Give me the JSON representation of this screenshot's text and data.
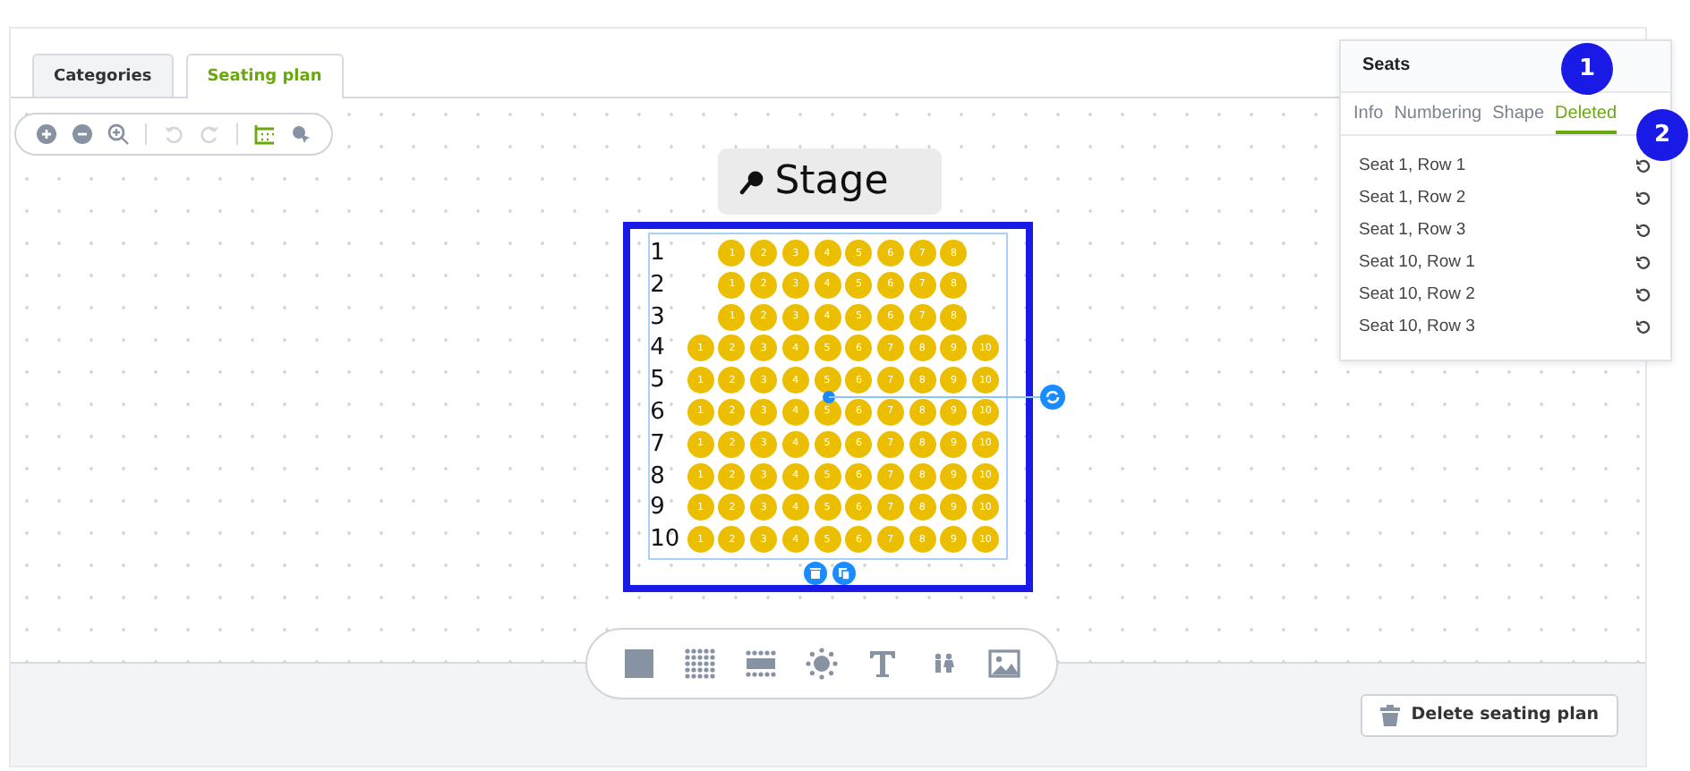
{
  "tabs": [
    {
      "label": "Categories",
      "selected": false
    },
    {
      "label": "Seating plan",
      "selected": true
    }
  ],
  "canvas_toolbar": [
    {
      "kind": "zoom-in",
      "disabled": false
    },
    {
      "kind": "zoom-out",
      "disabled": false
    },
    {
      "kind": "zoom-fit",
      "disabled": false
    },
    {
      "kind": "undo",
      "disabled": true
    },
    {
      "kind": "redo",
      "disabled": true
    },
    {
      "kind": "grid",
      "disabled": false
    },
    {
      "kind": "pointer",
      "disabled": false
    }
  ],
  "stage": {
    "label": "Stage"
  },
  "seat_block": {
    "selected": true,
    "rows": [
      {
        "label": "1",
        "seats": [
          {
            "kind": "gap"
          },
          {
            "kind": "seat",
            "label": "1"
          },
          {
            "kind": "seat",
            "label": "2"
          },
          {
            "kind": "seat",
            "label": "3"
          },
          {
            "kind": "seat",
            "label": "4"
          },
          {
            "kind": "seat",
            "label": "5"
          },
          {
            "kind": "seat",
            "label": "6"
          },
          {
            "kind": "seat",
            "label": "7"
          },
          {
            "kind": "seat",
            "label": "8"
          },
          {
            "kind": "gap"
          }
        ]
      },
      {
        "label": "2",
        "seats": [
          {
            "kind": "gap"
          },
          {
            "kind": "seat",
            "label": "1"
          },
          {
            "kind": "seat",
            "label": "2"
          },
          {
            "kind": "seat",
            "label": "3"
          },
          {
            "kind": "seat",
            "label": "4"
          },
          {
            "kind": "seat",
            "label": "5"
          },
          {
            "kind": "seat",
            "label": "6"
          },
          {
            "kind": "seat",
            "label": "7"
          },
          {
            "kind": "seat",
            "label": "8"
          },
          {
            "kind": "gap"
          }
        ]
      },
      {
        "label": "3",
        "seats": [
          {
            "kind": "gap"
          },
          {
            "kind": "seat",
            "label": "1"
          },
          {
            "kind": "seat",
            "label": "2"
          },
          {
            "kind": "seat",
            "label": "3"
          },
          {
            "kind": "seat",
            "label": "4"
          },
          {
            "kind": "seat",
            "label": "5"
          },
          {
            "kind": "seat",
            "label": "6"
          },
          {
            "kind": "seat",
            "label": "7"
          },
          {
            "kind": "seat",
            "label": "8"
          },
          {
            "kind": "gap"
          }
        ]
      },
      {
        "label": "4",
        "seats": [
          {
            "kind": "seat",
            "label": "1"
          },
          {
            "kind": "seat",
            "label": "2"
          },
          {
            "kind": "seat",
            "label": "3"
          },
          {
            "kind": "seat",
            "label": "4"
          },
          {
            "kind": "seat",
            "label": "5"
          },
          {
            "kind": "seat",
            "label": "6"
          },
          {
            "kind": "seat",
            "label": "7"
          },
          {
            "kind": "seat",
            "label": "8"
          },
          {
            "kind": "seat",
            "label": "9"
          },
          {
            "kind": "seat",
            "label": "10"
          }
        ]
      },
      {
        "label": "5",
        "seats": [
          {
            "kind": "seat",
            "label": "1"
          },
          {
            "kind": "seat",
            "label": "2"
          },
          {
            "kind": "seat",
            "label": "3"
          },
          {
            "kind": "seat",
            "label": "4"
          },
          {
            "kind": "seat",
            "label": "5"
          },
          {
            "kind": "seat",
            "label": "6"
          },
          {
            "kind": "seat",
            "label": "7"
          },
          {
            "kind": "seat",
            "label": "8"
          },
          {
            "kind": "seat",
            "label": "9"
          },
          {
            "kind": "seat",
            "label": "10"
          }
        ]
      },
      {
        "label": "6",
        "seats": [
          {
            "kind": "seat",
            "label": "1"
          },
          {
            "kind": "seat",
            "label": "2"
          },
          {
            "kind": "seat",
            "label": "3"
          },
          {
            "kind": "seat",
            "label": "4"
          },
          {
            "kind": "seat",
            "label": "5"
          },
          {
            "kind": "seat",
            "label": "6"
          },
          {
            "kind": "seat",
            "label": "7"
          },
          {
            "kind": "seat",
            "label": "8"
          },
          {
            "kind": "seat",
            "label": "9"
          },
          {
            "kind": "seat",
            "label": "10"
          }
        ]
      },
      {
        "label": "7",
        "seats": [
          {
            "kind": "seat",
            "label": "1"
          },
          {
            "kind": "seat",
            "label": "2"
          },
          {
            "kind": "seat",
            "label": "3"
          },
          {
            "kind": "seat",
            "label": "4"
          },
          {
            "kind": "seat",
            "label": "5"
          },
          {
            "kind": "seat",
            "label": "6"
          },
          {
            "kind": "seat",
            "label": "7"
          },
          {
            "kind": "seat",
            "label": "8"
          },
          {
            "kind": "seat",
            "label": "9"
          },
          {
            "kind": "seat",
            "label": "10"
          }
        ]
      },
      {
        "label": "8",
        "seats": [
          {
            "kind": "seat",
            "label": "1"
          },
          {
            "kind": "seat",
            "label": "2"
          },
          {
            "kind": "seat",
            "label": "3"
          },
          {
            "kind": "seat",
            "label": "4"
          },
          {
            "kind": "seat",
            "label": "5"
          },
          {
            "kind": "seat",
            "label": "6"
          },
          {
            "kind": "seat",
            "label": "7"
          },
          {
            "kind": "seat",
            "label": "8"
          },
          {
            "kind": "seat",
            "label": "9"
          },
          {
            "kind": "seat",
            "label": "10"
          }
        ]
      },
      {
        "label": "9",
        "seats": [
          {
            "kind": "seat",
            "label": "1"
          },
          {
            "kind": "seat",
            "label": "2"
          },
          {
            "kind": "seat",
            "label": "3"
          },
          {
            "kind": "seat",
            "label": "4"
          },
          {
            "kind": "seat",
            "label": "5"
          },
          {
            "kind": "seat",
            "label": "6"
          },
          {
            "kind": "seat",
            "label": "7"
          },
          {
            "kind": "seat",
            "label": "8"
          },
          {
            "kind": "seat",
            "label": "9"
          },
          {
            "kind": "seat",
            "label": "10"
          }
        ]
      },
      {
        "label": "10",
        "seats": [
          {
            "kind": "seat",
            "label": "1"
          },
          {
            "kind": "seat",
            "label": "2"
          },
          {
            "kind": "seat",
            "label": "3"
          },
          {
            "kind": "seat",
            "label": "4"
          },
          {
            "kind": "seat",
            "label": "5"
          },
          {
            "kind": "seat",
            "label": "6"
          },
          {
            "kind": "seat",
            "label": "7"
          },
          {
            "kind": "seat",
            "label": "8"
          },
          {
            "kind": "seat",
            "label": "9"
          },
          {
            "kind": "seat",
            "label": "10"
          }
        ]
      }
    ]
  },
  "shape_toolbar": [
    {
      "kind": "square"
    },
    {
      "kind": "seat-grid"
    },
    {
      "kind": "table"
    },
    {
      "kind": "round-table"
    },
    {
      "kind": "text"
    },
    {
      "kind": "restroom"
    },
    {
      "kind": "image"
    }
  ],
  "delete_button": "Delete seating plan",
  "seats_panel": {
    "title": "Seats",
    "tabs": [
      {
        "label": "Info",
        "selected": false
      },
      {
        "label": "Numbering",
        "selected": false
      },
      {
        "label": "Shape",
        "selected": false
      },
      {
        "label": "Deleted",
        "selected": true
      }
    ],
    "deleted_seats": [
      "Seat 1, Row 1",
      "Seat 1, Row 2",
      "Seat 1, Row 3",
      "Seat 10, Row 1",
      "Seat 10, Row 2",
      "Seat 10, Row 3"
    ]
  },
  "annotations": [
    "1",
    "2"
  ]
}
